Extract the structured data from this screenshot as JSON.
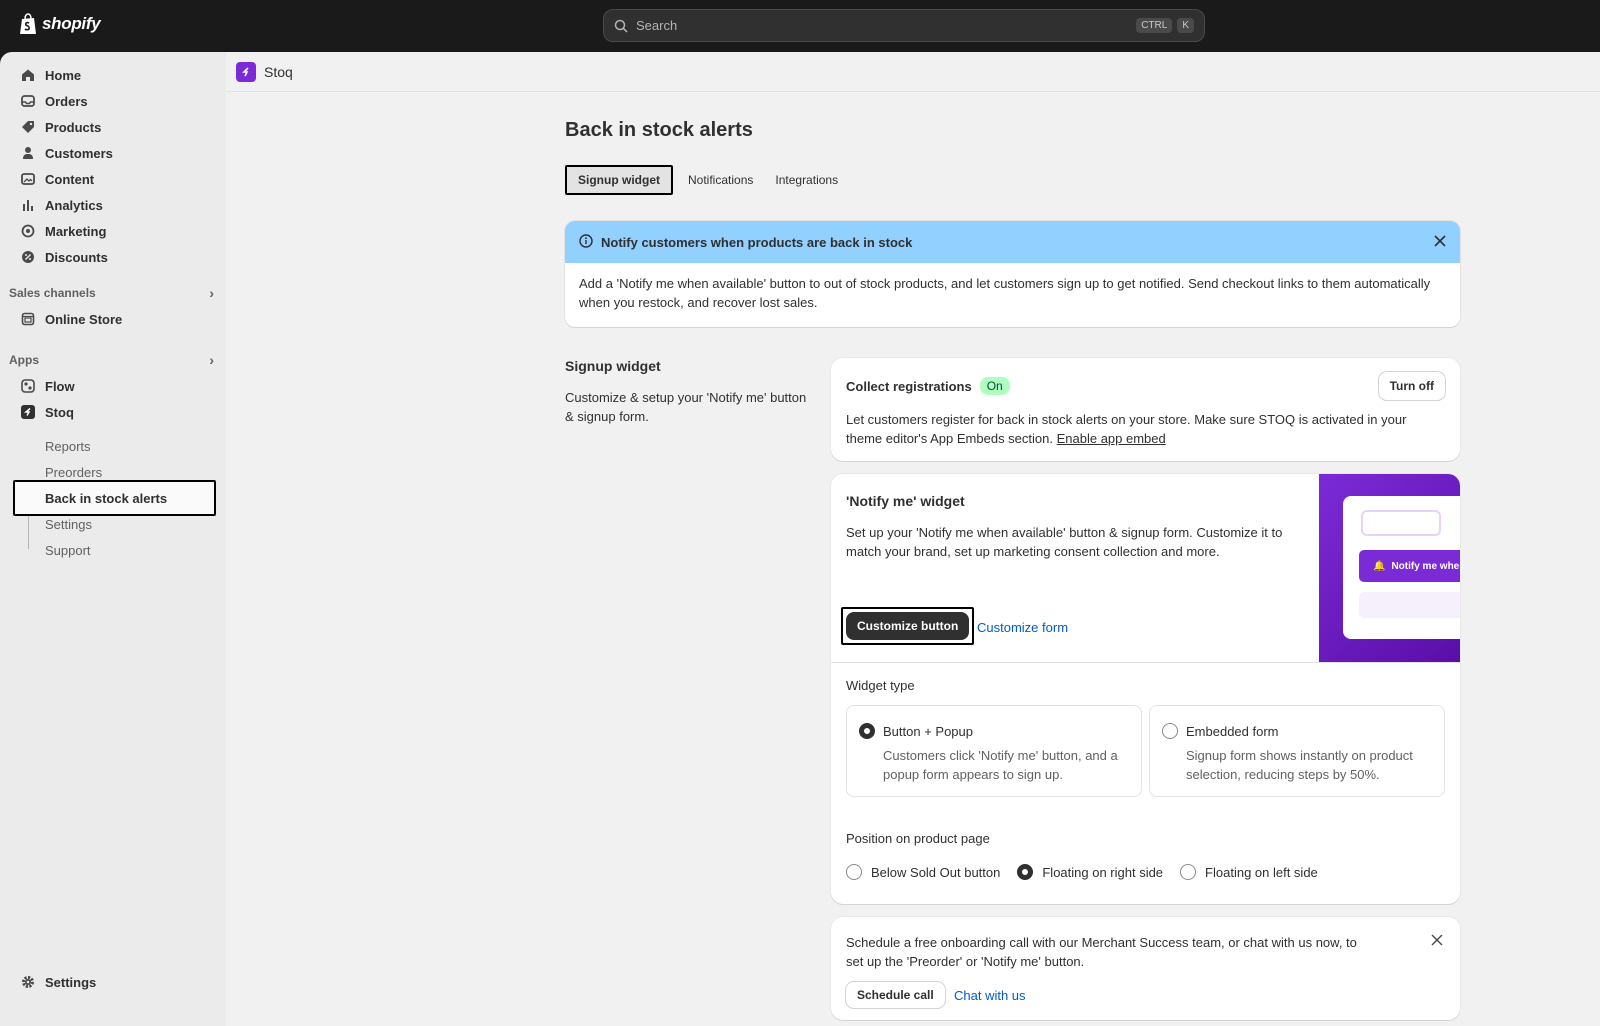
{
  "topbar": {
    "brand": "shopify",
    "search_placeholder": "Search",
    "shortcut_key1": "CTRL",
    "shortcut_key2": "K"
  },
  "sidebar": {
    "main_items": [
      {
        "label": "Home",
        "icon": "home-icon"
      },
      {
        "label": "Orders",
        "icon": "inbox-icon"
      },
      {
        "label": "Products",
        "icon": "tag-icon"
      },
      {
        "label": "Customers",
        "icon": "person-icon"
      },
      {
        "label": "Content",
        "icon": "image-icon"
      },
      {
        "label": "Analytics",
        "icon": "bar-chart-icon"
      },
      {
        "label": "Marketing",
        "icon": "target-icon"
      },
      {
        "label": "Discounts",
        "icon": "discount-icon"
      }
    ],
    "sales_channels_label": "Sales channels",
    "online_store": "Online Store",
    "apps_label": "Apps",
    "flow": "Flow",
    "stoq": "Stoq",
    "stoq_sub": [
      "Reports",
      "Preorders",
      "Back in stock alerts",
      "Settings",
      "Support"
    ],
    "settings": "Settings"
  },
  "app_bar": {
    "name": "Stoq"
  },
  "page": {
    "title": "Back in stock alerts",
    "tabs": [
      "Signup widget",
      "Notifications",
      "Integrations"
    ]
  },
  "banner": {
    "title": "Notify customers when products are back in stock",
    "body": "Add a 'Notify me when available' button to out of stock products, and let customers sign up to get notified. Send checkout links to them automatically when you restock, and recover lost sales."
  },
  "signup_section": {
    "title": "Signup widget",
    "description": "Customize & setup your 'Notify me' button & signup form."
  },
  "collect_card": {
    "title": "Collect registrations",
    "badge": "On",
    "button": "Turn off",
    "text": "Let customers register for back in stock alerts on your store. Make sure STOQ is activated in your theme editor's App Embeds section.",
    "link": "Enable app embed"
  },
  "widget_card": {
    "title": "'Notify me' widget",
    "text": "Set up your 'Notify me when available' button & signup form. Customize it to match your brand, set up marketing consent collection and more.",
    "primary_button": "Customize button",
    "secondary_link": "Customize form",
    "preview_button": "Notify me when",
    "widget_type_label": "Widget type",
    "options": [
      {
        "title": "Button + Popup",
        "desc": "Customers click 'Notify me' button, and a popup form appears to sign up.",
        "selected": true
      },
      {
        "title": "Embedded form",
        "desc": "Signup form shows instantly on product selection, reducing steps by 50%.",
        "selected": false
      }
    ],
    "position_label": "Position on product page",
    "positions": [
      {
        "label": "Below Sold Out button",
        "selected": false
      },
      {
        "label": "Floating on right side",
        "selected": true
      },
      {
        "label": "Floating on left side",
        "selected": false
      }
    ]
  },
  "onboarding_card": {
    "text": "Schedule a free onboarding call with our Merchant Success team, or chat with us now, to set up the 'Preorder' or 'Notify me' button.",
    "button": "Schedule call",
    "link": "Chat with us"
  },
  "colors": {
    "accent": "#7b2bd6",
    "banner_bg": "#91d0ff",
    "link": "#005bd3",
    "badge_bg": "#affebf"
  }
}
